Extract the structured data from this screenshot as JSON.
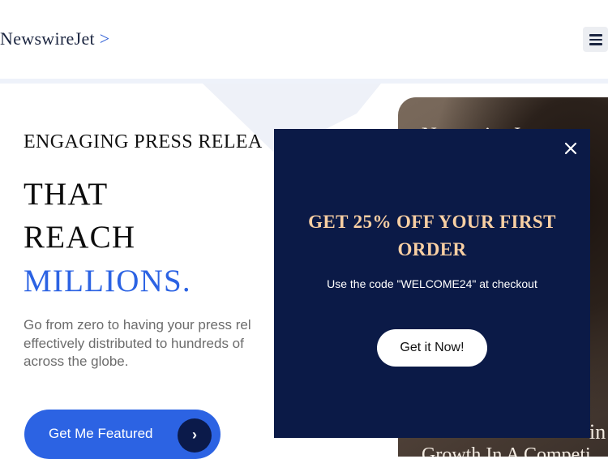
{
  "header": {
    "brand": "NewswireJet",
    "brand_arrow": ">",
    "menu_icon": "hamburger-menu-icon"
  },
  "hero": {
    "eyebrow": "ENGAGING PRESS RELEA",
    "headline_lines": [
      "THAT",
      "REACH"
    ],
    "headline_accent": "MILLIONS.",
    "description_lines": [
      "Go from zero to having your press rel",
      "effectively distributed to hundreds of",
      "across the globe."
    ],
    "cta_label": "Get Me Featured",
    "cta_icon": "chevron-right-icon",
    "photo_caption_top": "Newswire Jet",
    "photo_caption_right": "in",
    "photo_caption_bottom": "Growth In A Competi"
  },
  "popup": {
    "close_icon": "close-icon",
    "title_line1": "GET 25% OFF YOUR FIRST",
    "title_line2": "ORDER",
    "subtitle": "Use the code \"WELCOME24\" at checkout",
    "button_label": "Get it Now!"
  },
  "colors": {
    "accent": "#2c63e3",
    "popup_bg": "#0b1a47",
    "popup_title": "#f8cfa3"
  }
}
